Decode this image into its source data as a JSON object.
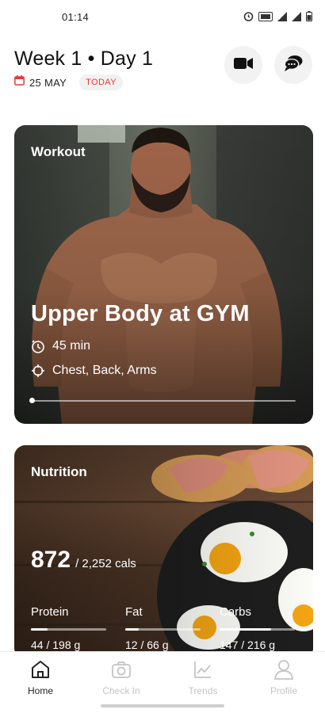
{
  "status_bar": {
    "time": "01:14"
  },
  "header": {
    "title": "Week 1 • Day 1",
    "date": "25 MAY",
    "today_badge": "TODAY",
    "accent_color": "#e53935"
  },
  "workout": {
    "label": "Workout",
    "title": "Upper Body at GYM",
    "duration": "45 min",
    "muscles": "Chest, Back, Arms",
    "progress": 0
  },
  "nutrition": {
    "label": "Nutrition",
    "calories": "872",
    "calories_total": "/ 2,252 cals",
    "macros": [
      {
        "label": "Protein",
        "value": "44 / 198 g",
        "fraction": 0.22
      },
      {
        "label": "Fat",
        "value": "12 / 66 g",
        "fraction": 0.18
      },
      {
        "label": "Carbs",
        "value": "147 / 216 g",
        "fraction": 0.68
      }
    ]
  },
  "nav": {
    "items": [
      {
        "label": "Home",
        "icon": "home-icon",
        "active": true
      },
      {
        "label": "Check In",
        "icon": "camera-icon",
        "active": false
      },
      {
        "label": "Trends",
        "icon": "chart-icon",
        "active": false
      },
      {
        "label": "Profile",
        "icon": "profile-icon",
        "active": false
      }
    ]
  }
}
